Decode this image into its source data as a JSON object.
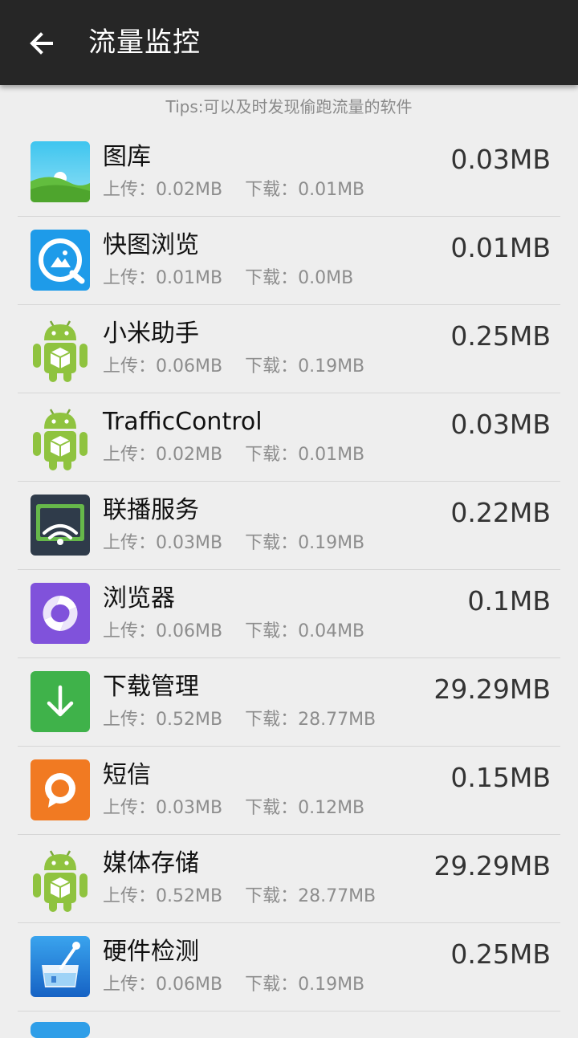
{
  "appbar": {
    "title": "流量监控",
    "back_icon": "arrow-left-icon"
  },
  "tips": "Tips:可以及时发现偷跑流量的软件",
  "labels": {
    "upload": "上传：",
    "download": "下载："
  },
  "apps": [
    {
      "name": "图库",
      "upload": "0.02MB",
      "download": "0.01MB",
      "total": "0.03MB",
      "icon": "gallery-icon"
    },
    {
      "name": "快图浏览",
      "upload": "0.01MB",
      "download": "0.0MB",
      "total": "0.01MB",
      "icon": "quickpic-icon"
    },
    {
      "name": "小米助手",
      "upload": "0.06MB",
      "download": "0.19MB",
      "total": "0.25MB",
      "icon": "android-icon"
    },
    {
      "name": "TrafficControl",
      "upload": "0.02MB",
      "download": "0.01MB",
      "total": "0.03MB",
      "icon": "android-icon"
    },
    {
      "name": "联播服务",
      "upload": "0.03MB",
      "download": "0.19MB",
      "total": "0.22MB",
      "icon": "cast-icon"
    },
    {
      "name": "浏览器",
      "upload": "0.06MB",
      "download": "0.04MB",
      "total": "0.1MB",
      "icon": "browser-icon"
    },
    {
      "name": "下载管理",
      "upload": "0.52MB",
      "download": "28.77MB",
      "total": "29.29MB",
      "icon": "download-icon"
    },
    {
      "name": "短信",
      "upload": "0.03MB",
      "download": "0.12MB",
      "total": "0.15MB",
      "icon": "message-icon"
    },
    {
      "name": "媒体存储",
      "upload": "0.52MB",
      "download": "28.77MB",
      "total": "29.29MB",
      "icon": "android-icon"
    },
    {
      "name": "硬件检测",
      "upload": "0.06MB",
      "download": "0.19MB",
      "total": "0.25MB",
      "icon": "hardware-test-icon"
    }
  ]
}
